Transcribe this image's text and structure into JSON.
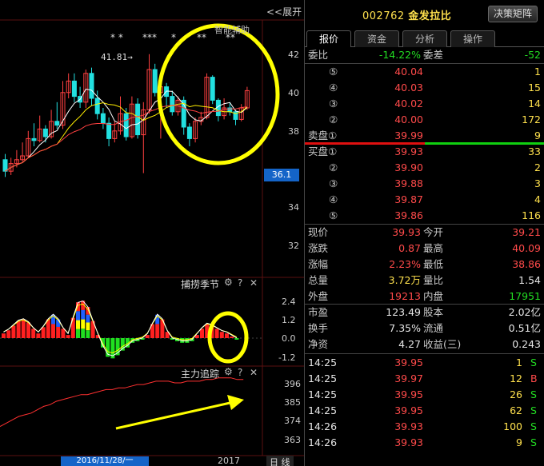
{
  "chart": {
    "expand_label": "<<展开",
    "smart_assist": "智能辅助",
    "price_marker": "41.81→",
    "stars": [
      "* *",
      "***",
      "*",
      "**",
      "**"
    ],
    "price_axis": [
      "42",
      "40",
      "38",
      "36.1",
      "34",
      "32"
    ],
    "current_price_tag": "36.1",
    "indicator1_title": "捕捞季节",
    "indicator1_axis": [
      "2.4",
      "1.2",
      "0.0",
      "-1.2"
    ],
    "indicator2_title": "主力追踪",
    "indicator2_axis": [
      "396",
      "385",
      "374",
      "363"
    ],
    "date_label": "2016/11/28/一",
    "year_label": "2017",
    "period_button": "日 线",
    "colors": {
      "up": "#ff4040",
      "down": "#22e0e0",
      "annotation": "#ffff00",
      "line_white": "#ffffff",
      "line_yellow": "#ffee00"
    }
  },
  "stock": {
    "code": "002762",
    "name": "金发拉比",
    "decision_button": "决策矩阵"
  },
  "tabs": [
    "报价",
    "资金",
    "分析",
    "操作"
  ],
  "commission": {
    "ratio_label": "委比",
    "ratio": "-14.22%",
    "diff_label": "委差",
    "diff": "-52"
  },
  "asks": [
    {
      "level": "⑤",
      "price": "40.04",
      "vol": "1"
    },
    {
      "level": "④",
      "price": "40.03",
      "vol": "15"
    },
    {
      "level": "③",
      "price": "40.02",
      "vol": "14"
    },
    {
      "level": "②",
      "price": "40.00",
      "vol": "172"
    },
    {
      "level": "卖盘①",
      "price": "39.99",
      "vol": "9"
    }
  ],
  "bids": [
    {
      "level": "买盘①",
      "price": "39.93",
      "vol": "33"
    },
    {
      "level": "②",
      "price": "39.90",
      "vol": "2"
    },
    {
      "level": "③",
      "price": "39.88",
      "vol": "3"
    },
    {
      "level": "④",
      "price": "39.87",
      "vol": "4"
    },
    {
      "level": "⑤",
      "price": "39.86",
      "vol": "116"
    }
  ],
  "quote": [
    {
      "l1": "现价",
      "v1": "39.93",
      "c1": "red",
      "l2": "今开",
      "v2": "39.21",
      "c2": "red"
    },
    {
      "l1": "涨跌",
      "v1": "0.87",
      "c1": "red",
      "l2": "最高",
      "v2": "40.09",
      "c2": "red"
    },
    {
      "l1": "涨幅",
      "v1": "2.23%",
      "c1": "red",
      "l2": "最低",
      "v2": "38.86",
      "c2": "red"
    },
    {
      "l1": "总量",
      "v1": "3.72万",
      "c1": "yel",
      "l2": "量比",
      "v2": "1.54",
      "c2": "wht"
    },
    {
      "l1": "外盘",
      "v1": "19213",
      "c1": "red",
      "l2": "内盘",
      "v2": "17951",
      "c2": "grn"
    }
  ],
  "fundamentals": [
    {
      "l1": "市盈",
      "v1": "123.49",
      "l2": "股本",
      "v2": "2.02亿"
    },
    {
      "l1": "换手",
      "v1": "7.35%",
      "l2": "流通",
      "v2": "0.51亿"
    },
    {
      "l1": "净资",
      "v1": "4.27",
      "l2": "收益(三)",
      "v2": "0.243"
    }
  ],
  "ticks": [
    {
      "time": "14:25",
      "price": "39.95",
      "vol": "1",
      "side": "S"
    },
    {
      "time": "14:25",
      "price": "39.97",
      "vol": "12",
      "side": "B"
    },
    {
      "time": "14:25",
      "price": "39.95",
      "vol": "26",
      "side": "S"
    },
    {
      "time": "14:25",
      "price": "39.95",
      "vol": "62",
      "side": "S"
    },
    {
      "time": "14:26",
      "price": "39.93",
      "vol": "100",
      "side": "S"
    },
    {
      "time": "14:26",
      "price": "39.93",
      "vol": "9",
      "side": "S"
    }
  ]
}
